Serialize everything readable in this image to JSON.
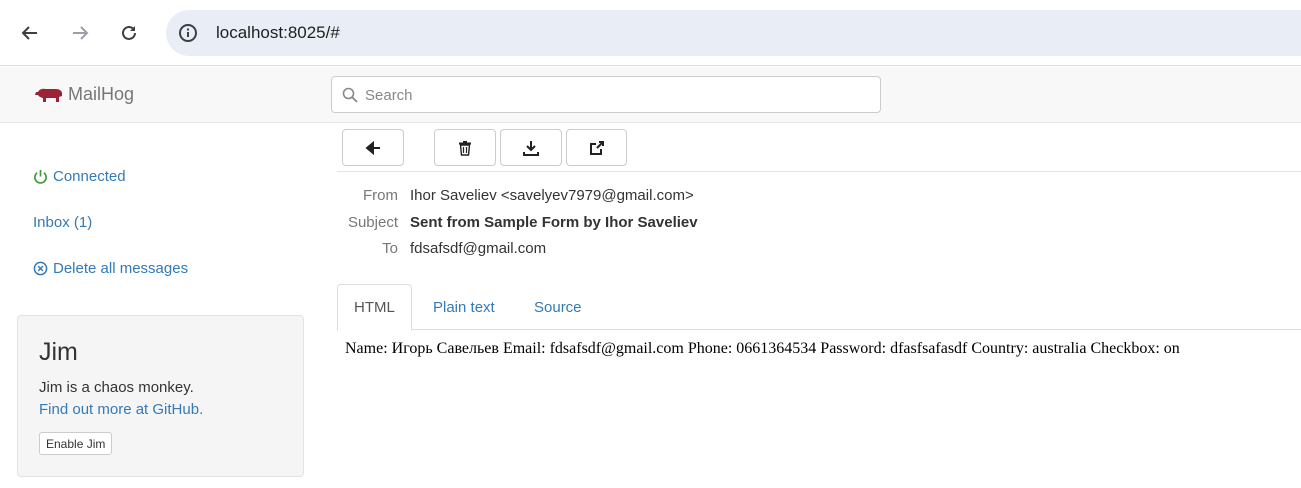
{
  "browser": {
    "url": "localhost:8025/#"
  },
  "header": {
    "brand": "MailHog",
    "search_placeholder": "Search"
  },
  "sidebar": {
    "connected": "Connected",
    "inbox": "Inbox (1)",
    "delete_all": "Delete all messages"
  },
  "jim": {
    "title": "Jim",
    "description": "Jim is a chaos monkey.",
    "link": "Find out more at GitHub.",
    "button": "Enable Jim"
  },
  "message": {
    "from_label": "From",
    "from": "Ihor Saveliev <savelyev7979@gmail.com>",
    "subject_label": "Subject",
    "subject": "Sent from Sample Form by Ihor Saveliev",
    "to_label": "To",
    "to": "fdsafsdf@gmail.com",
    "tabs": [
      "HTML",
      "Plain text",
      "Source"
    ],
    "body": "Name: Игорь Савельев Email: fdsafsdf@gmail.com Phone: 0661364534 Password: dfasfsafasdf Country: australia Checkbox: on"
  },
  "colors": {
    "brand_pig": "#9b2335",
    "link": "#337ab7",
    "connected_icon": "#3c9a3c"
  }
}
